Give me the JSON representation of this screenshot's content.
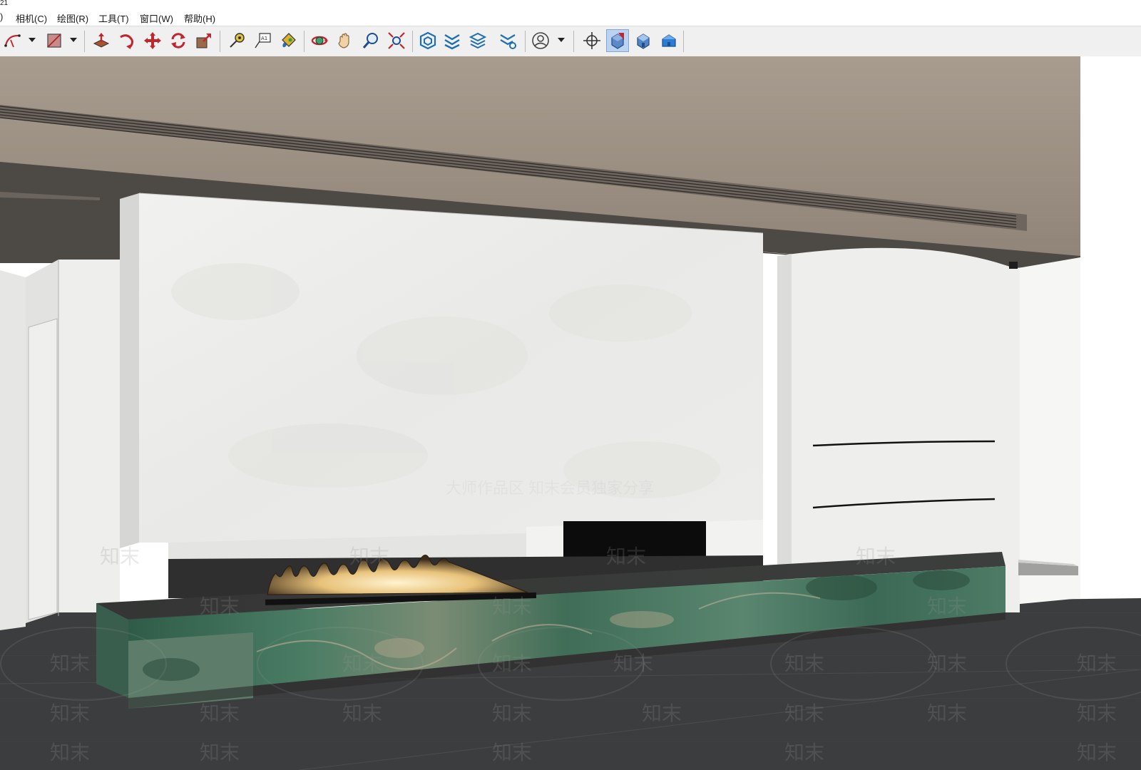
{
  "window": {
    "title_fragment": "21"
  },
  "menubar": {
    "items": [
      {
        "id": "view",
        "label": ")"
      },
      {
        "id": "camera",
        "label": "相机(C)"
      },
      {
        "id": "draw",
        "label": "绘图(R)"
      },
      {
        "id": "tools",
        "label": "工具(T)"
      },
      {
        "id": "window",
        "label": "窗口(W)"
      },
      {
        "id": "help",
        "label": "帮助(H)"
      }
    ]
  },
  "toolbar": {
    "buttons": [
      {
        "id": "arc-tool",
        "icon": "arc-icon",
        "has_dropdown": true
      },
      {
        "id": "shapes-tool",
        "icon": "rectangle-shape-icon",
        "has_dropdown": true
      },
      {
        "id": "push-pull-tool",
        "icon": "push-pull-icon"
      },
      {
        "id": "follow-me-tool",
        "icon": "follow-me-icon"
      },
      {
        "id": "move-tool",
        "icon": "move-icon"
      },
      {
        "id": "rotate-tool",
        "icon": "rotate-icon"
      },
      {
        "id": "scale-tool",
        "icon": "scale-icon"
      },
      {
        "id": "tape-measure-tool",
        "icon": "tape-measure-icon"
      },
      {
        "id": "text-tool",
        "icon": "text-icon",
        "label": "A1"
      },
      {
        "id": "paint-bucket-tool",
        "icon": "paint-bucket-icon"
      },
      {
        "id": "orbit-tool",
        "icon": "orbit-icon"
      },
      {
        "id": "pan-tool",
        "icon": "hand-pan-icon"
      },
      {
        "id": "zoom-tool",
        "icon": "zoom-icon"
      },
      {
        "id": "zoom-extents-tool",
        "icon": "zoom-extents-icon"
      },
      {
        "id": "warehouse-button",
        "icon": "3d-warehouse-icon"
      },
      {
        "id": "extension-warehouse-button",
        "icon": "extension-warehouse-icon"
      },
      {
        "id": "send-to-layout-button",
        "icon": "layout-icon"
      },
      {
        "id": "extension-manager-button",
        "icon": "extension-manager-icon"
      },
      {
        "id": "account-button",
        "icon": "user-account-icon",
        "has_dropdown": true
      },
      {
        "id": "position-camera-tool",
        "icon": "position-camera-icon"
      },
      {
        "id": "section-view-button",
        "icon": "section-plane-icon",
        "active": true
      },
      {
        "id": "iso-view-button",
        "icon": "iso-house-icon"
      },
      {
        "id": "front-view-button",
        "icon": "front-house-icon"
      }
    ]
  },
  "scene": {
    "watermark_text": "知末",
    "banner_text": "大师作品区 知末会员独家分享",
    "colors": {
      "wood_ceiling": "#a39688",
      "ceiling_underside": "#4d4945",
      "white_plaster": "#ececea",
      "dark_floor": "#3c3d3e",
      "green_marble": "#3d6a55",
      "fire_glow": "#e8c27a"
    }
  }
}
